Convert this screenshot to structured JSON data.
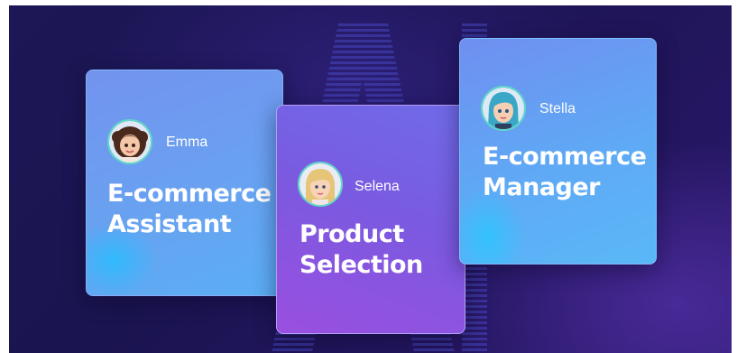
{
  "cards": [
    {
      "name": "Emma",
      "role_line1": "E-commerce",
      "role_line2": "Assistant"
    },
    {
      "name": "Selena",
      "role_line1": "Product",
      "role_line2": "Selection"
    },
    {
      "name": "Stella",
      "role_line1": "E-commerce",
      "role_line2": "Manager"
    }
  ],
  "colors": {
    "background": "#1d1756",
    "avatar_ring": "#5fd8c6",
    "card_blue": "#6aa0f0",
    "card_purple": "#7a5ae0"
  }
}
